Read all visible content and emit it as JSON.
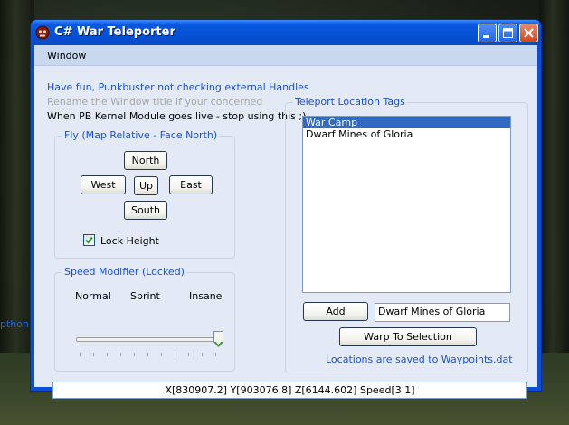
{
  "window": {
    "title": "C# War Teleporter",
    "menu": [
      "Window"
    ]
  },
  "info": {
    "line1": "Have fun, Punkbuster not checking external Handles",
    "line2": "Rename the Window title if your concerned",
    "line3": "When PB Kernel Module goes live - stop using this ;)"
  },
  "fly": {
    "group_label": "Fly (Map Relative - Face North)",
    "north": "North",
    "west": "West",
    "up": "Up",
    "east": "East",
    "south": "South",
    "lock_height_label": "Lock Height",
    "lock_height_checked": true
  },
  "speed": {
    "group_label": "Speed Modifier (Locked)",
    "labels": [
      "Normal",
      "Sprint",
      "Insane"
    ],
    "level": 1.0
  },
  "teleport": {
    "group_label": "Teleport Location Tags",
    "items": [
      "War Camp",
      "Dwarf Mines of Gloria"
    ],
    "selected_index": 0,
    "add_label": "Add",
    "name_value": "Dwarf Mines of Gloria",
    "warp_label": "Warp To Selection",
    "saved_note": "Locations are saved to Waypoints.dat"
  },
  "status": "X[830907.2] Y[903076.8] Z[6144.602] Speed[3.1]",
  "background_text": "pthon",
  "colors": {
    "titlebar": "#0550d4",
    "accent_text": "#1d52c8",
    "selection": "#316ac5"
  }
}
